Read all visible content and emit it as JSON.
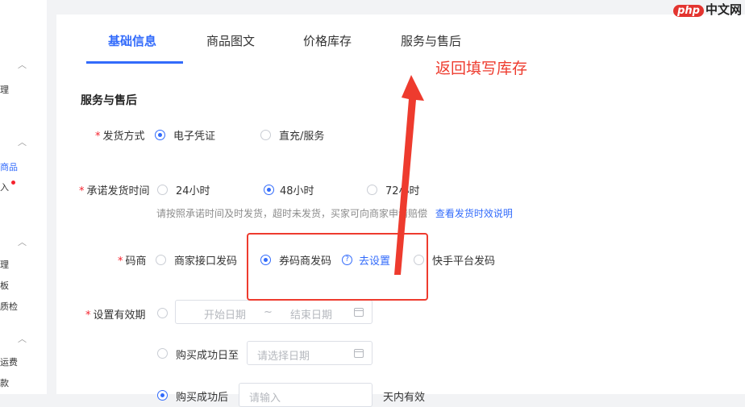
{
  "sidebar": {
    "items": [
      {
        "label": "理",
        "active": false
      },
      {
        "label": "商品",
        "active": true
      },
      {
        "label": "入",
        "active": false,
        "dot": true
      },
      {
        "label": "理",
        "active": false
      },
      {
        "label": "板",
        "active": false
      },
      {
        "label": "质检",
        "active": false
      },
      {
        "label": "运费",
        "active": false
      },
      {
        "label": "款",
        "active": false
      }
    ]
  },
  "tabs": [
    "基础信息",
    "商品图文",
    "价格库存",
    "服务与售后"
  ],
  "section_title": "服务与售后",
  "delivery_method": {
    "label": "发货方式",
    "options": [
      "电子凭证",
      "直充/服务"
    ]
  },
  "delivery_time": {
    "label": "承诺发货时间",
    "options": [
      "24小时",
      "48小时",
      "72小时"
    ],
    "hint": "请按照承诺时间及时发货，超时未发货，买家可向商家申请赔偿",
    "hint_link": "查看发货时效说明"
  },
  "code_provider": {
    "label": "码商",
    "options": [
      "商家接口发码",
      "券码商发码",
      "快手平台发码"
    ],
    "setup_link": "去设置"
  },
  "validity": {
    "label": "设置有效期",
    "start_placeholder": "开始日期",
    "separator": "~",
    "end_placeholder": "结束日期",
    "until_label": "购买成功日至",
    "until_placeholder": "请选择日期",
    "after_label": "购买成功后",
    "after_placeholder": "请输入",
    "after_suffix": "天内有效"
  },
  "annotation": {
    "text": "返回填写库存",
    "color": "#ee3b2e"
  },
  "watermark": {
    "brand": "php",
    "text": "中文网"
  },
  "colors": {
    "accent": "#326bfb",
    "required": "#f5222d"
  }
}
